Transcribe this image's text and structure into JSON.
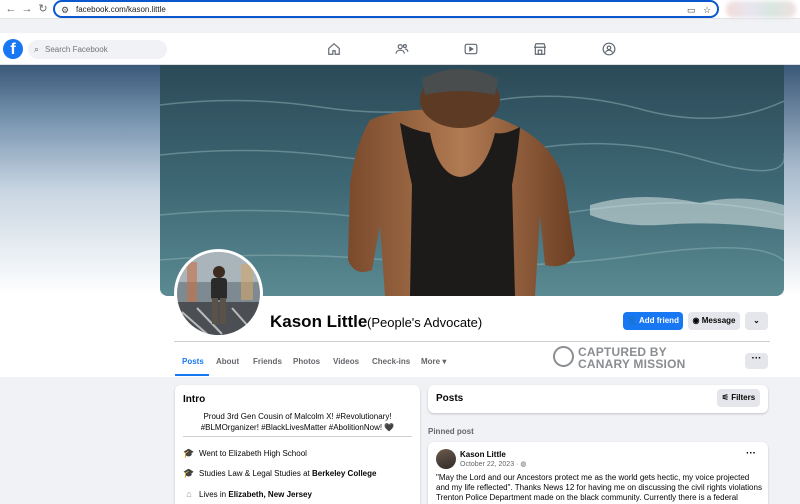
{
  "browser": {
    "url": "facebook.com/kason.little"
  },
  "topbar": {
    "logo": "f",
    "search_placeholder": "Search Facebook",
    "nav_icons": [
      "home-icon",
      "friends-icon",
      "video-icon",
      "marketplace-icon",
      "groups-icon"
    ]
  },
  "profile": {
    "name": "Kason Little",
    "alternate_name": "(People's Advocate)",
    "add_friend_label": "Add friend",
    "message_label": "Message",
    "more_label": "⌄"
  },
  "tabs": [
    "Posts",
    "About",
    "Friends",
    "Photos",
    "Videos",
    "Check-ins",
    "More ▾"
  ],
  "active_tab": "Posts",
  "watermark": {
    "line1": "CAPTURED BY",
    "line2": "CANARY MISSION"
  },
  "intro": {
    "title": "Intro",
    "bio": "Proud 3rd Gen Cousin of Malcolm X! #Revolutionary! #BLMOrganizer! #BlackLivesMatter #AbolitionNow! 🖤",
    "items": [
      {
        "icon": "graduation-cap-icon",
        "prefix": "Went to Elizabeth High School",
        "bold": ""
      },
      {
        "icon": "graduation-cap-icon",
        "prefix": "Studies Law & Legal Studies at ",
        "bold": "Berkeley College"
      },
      {
        "icon": "home-icon",
        "prefix": "Lives in ",
        "bold": "Elizabeth, New Jersey"
      }
    ]
  },
  "posts": {
    "title": "Posts",
    "filters_label": "Filters",
    "pinned_label": "Pinned post",
    "post": {
      "author": "Kason Little",
      "date": "October 22, 2023 · ",
      "text": "\"May the Lord and our Ancestors protect me as the world gets hectic, my voice projected and my life reflected\". Thanks News 12 for having me on discussing the civil rights violations Trenton Police Department made on the black community. Currently there is a federal investigation into"
    }
  },
  "colors": {
    "accent": "#1877f2",
    "page_bg": "#f0f2f5",
    "url_border": "#0b57d0"
  }
}
